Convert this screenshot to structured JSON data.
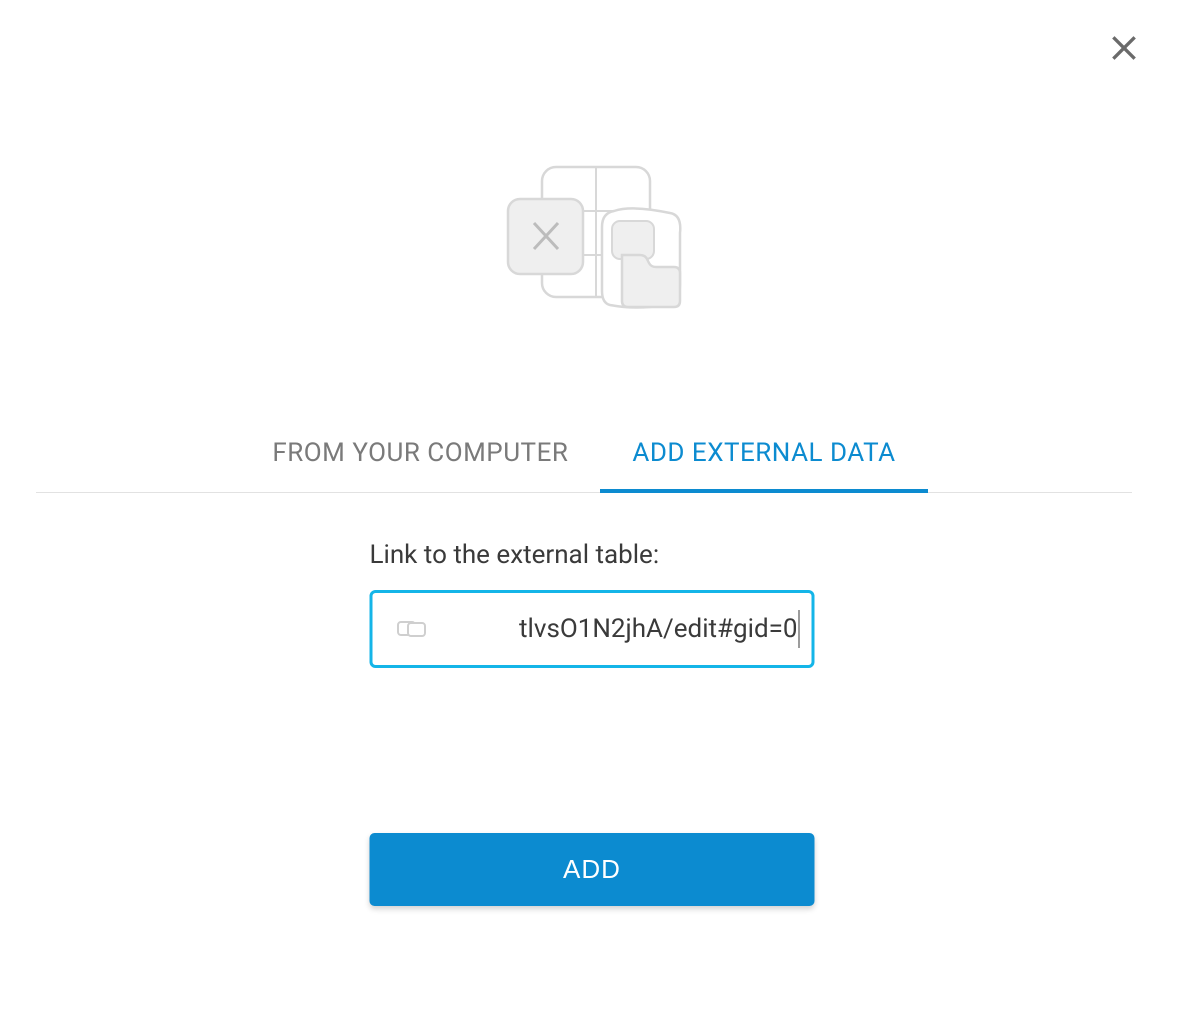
{
  "tabs": {
    "from_computer": "FROM YOUR COMPUTER",
    "add_external": "ADD EXTERNAL DATA"
  },
  "form": {
    "label": "Link to the external table:",
    "url_value": "tlvsO1N2jhA/edit#gid=0"
  },
  "buttons": {
    "add": "ADD"
  }
}
